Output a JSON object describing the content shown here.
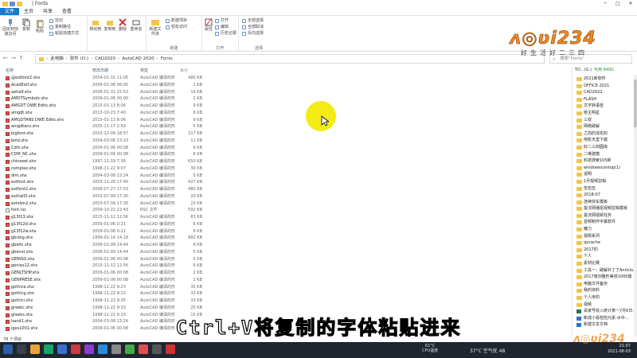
{
  "window": {
    "title": "| Fonts",
    "tabs": [
      "文件",
      "主页",
      "共享",
      "查看"
    ]
  },
  "ribbon": {
    "clipboard": {
      "pin_label": "固定到快速访问",
      "copy_label": "复制",
      "paste_label": "粘贴",
      "cut_label": "剪切",
      "copy_path_label": "复制路径",
      "paste_shortcut_label": "粘贴快捷方式"
    },
    "organize": {
      "move_to_label": "移动到",
      "copy_to_label": "复制到",
      "delete_label": "删除",
      "rename_label": "重命名"
    },
    "new": {
      "new_folder_label": "新建文件夹",
      "new_item_label": "新建项目",
      "easy_access_label": "轻松访问",
      "group_label": "新建"
    },
    "open": {
      "properties_label": "属性",
      "open_label": "打开",
      "edit_label": "编辑",
      "history_label": "历史记录",
      "group_label": "打开"
    },
    "select": {
      "select_all_label": "全部选择",
      "select_none_label": "全部取消",
      "invert_label": "反向选择",
      "group_label": "选择"
    }
  },
  "address": {
    "path": [
      "此电脑",
      "软件 (D:)",
      "CAD2020",
      "AutoCAD 2020",
      "Fonts"
    ],
    "search_placeholder": "搜索\"Fonts\""
  },
  "filelist": {
    "columns": [
      "名称",
      "修改日期",
      "类型",
      "大小"
    ],
    "rows": [
      {
        "name": "@extfont2.shx",
        "date": "2004-01-31 11:05",
        "type": "AutoCAD 编译的形",
        "size": "480 KB",
        "kind": "shx"
      },
      {
        "name": "AcadEref.shx",
        "date": "2009-01-06 06:05",
        "type": "AutoCAD 编译的形",
        "size": "1 KB",
        "kind": "shx"
      },
      {
        "name": "aehalf.shx",
        "date": "2006-01-31 15:53",
        "type": "AutoCAD 编译的形",
        "size": "14 KB",
        "kind": "shx"
      },
      {
        "name": "AMDTSymbols.shx",
        "date": "2009-01-06 00:00",
        "type": "AutoCAD 编译的形",
        "size": "2 KB",
        "kind": "shx"
      },
      {
        "name": "AMGDT DWE Edits.shx",
        "date": "2015-01-13 8:06",
        "type": "AutoCAD 编译的形",
        "size": "9 KB",
        "kind": "shx"
      },
      {
        "name": "amgdt.shx",
        "date": "2013-10-23 7:40",
        "type": "AutoCAD 编译的形",
        "size": "6 KB",
        "kind": "shx"
      },
      {
        "name": "AMGDTANS DWE Edits.shx",
        "date": "2015-01-13 8:06",
        "type": "AutoCAD 编译的形",
        "size": "9 KB",
        "kind": "shx"
      },
      {
        "name": "amgdtans.shx",
        "date": "2005-11-17 2:59",
        "type": "AutoCAD 编译的形",
        "size": "5 KB",
        "kind": "shx"
      },
      {
        "name": "bigfont.shx",
        "date": "2003-12-09 18:57",
        "type": "AutoCAD 编译的形",
        "size": "217 KB",
        "kind": "shx"
      },
      {
        "name": "bold.shx",
        "date": "2004-03-08 23:23",
        "type": "AutoCAD 编译的形",
        "size": "11 KB",
        "kind": "shx"
      },
      {
        "name": "Cdm.shx",
        "date": "2009-01-06 00:08",
        "type": "AutoCAD 编译的形",
        "size": "6 KB",
        "kind": "shx"
      },
      {
        "name": "CDM_NC.shx",
        "date": "2009-01-06 00:08",
        "type": "AutoCAD 编译的形",
        "size": "6 KB",
        "kind": "shx"
      },
      {
        "name": "chineset.shx",
        "date": "1997-11-19 7:36",
        "type": "AutoCAD 编译的形",
        "size": "650 KB",
        "kind": "shx"
      },
      {
        "name": "complex.shx",
        "date": "1998-11-22 9:07",
        "type": "AutoCAD 编译的形",
        "size": "30 KB",
        "kind": "shx"
      },
      {
        "name": "dim.shx",
        "date": "2004-03-08 23:24",
        "type": "AutoCAD 编译的形",
        "size": "5 KB",
        "kind": "shx"
      },
      {
        "name": "extfont.shx",
        "date": "2003-11-28 17:40",
        "type": "AutoCAD 编译的形",
        "size": "427 KB",
        "kind": "shx"
      },
      {
        "name": "extfont2.shx",
        "date": "2006-07-27 17:03",
        "type": "AutoCAD 编译的形",
        "size": "480 KB",
        "kind": "shx"
      },
      {
        "name": "exthalf2.shx",
        "date": "2003-07-09 17:30",
        "type": "AutoCAD 编译的形",
        "size": "20 KB",
        "kind": "shx"
      },
      {
        "name": "extslim2.shx",
        "date": "2003-07-09 17:30",
        "type": "AutoCAD 编译的形",
        "size": "23 KB",
        "kind": "shx"
      },
      {
        "name": "font.rsc",
        "date": "2009-10-21 22:43",
        "type": "RSC 文件",
        "size": "592 KB",
        "kind": "rsc"
      },
      {
        "name": "g13f13.shx",
        "date": "2015-11-12 12:56",
        "type": "AutoCAD 编译的形",
        "size": "63 KB",
        "kind": "shx"
      },
      {
        "name": "g13f12d.shx",
        "date": "2009-01-06 0:21",
        "type": "AutoCAD 编译的形",
        "size": "6 KB",
        "kind": "shx"
      },
      {
        "name": "g13f12w.shx",
        "date": "2009-01-06 0:21",
        "type": "AutoCAD 编译的形",
        "size": "6 KB",
        "kind": "shx"
      },
      {
        "name": "gbcbig.shx",
        "date": "1999-01-14 14:18",
        "type": "AutoCAD 编译的形",
        "size": "882 KB",
        "kind": "shx"
      },
      {
        "name": "gbeitc.shx",
        "date": "2006-02-09 14:44",
        "type": "AutoCAD 编译的形",
        "size": "6 KB",
        "kind": "shx"
      },
      {
        "name": "gbenor.shx",
        "date": "2006-02-09 14:44",
        "type": "AutoCAD 编译的形",
        "size": "5 KB",
        "kind": "shx"
      },
      {
        "name": "GENISO.shx",
        "date": "2009-01-06 00:08",
        "type": "AutoCAD 编译的形",
        "size": "5 KB",
        "kind": "shx"
      },
      {
        "name": "geniso12.shx",
        "date": "2015-11-12 12:56",
        "type": "AutoCAD 编译的形",
        "size": "6 KB",
        "kind": "shx"
      },
      {
        "name": "GENLTSHP.shx",
        "date": "2009-01-06 00:08",
        "type": "AutoCAD 编译的形",
        "size": "2 KB",
        "kind": "shx"
      },
      {
        "name": "GENPRESE.shx",
        "date": "2009-01-06 00:08",
        "type": "AutoCAD 编译的形",
        "size": "1 KB",
        "kind": "shx"
      },
      {
        "name": "gothice.shx",
        "date": "1998-11-22 9:23",
        "type": "AutoCAD 编译的形",
        "size": "35 KB",
        "kind": "shx"
      },
      {
        "name": "gothicg.shx",
        "date": "1998-11-22 9:23",
        "type": "AutoCAD 编译的形",
        "size": "33 KB",
        "kind": "shx"
      },
      {
        "name": "gothici.shx",
        "date": "1998-11-22 9:35",
        "type": "AutoCAD 编译的形",
        "size": "33 KB",
        "kind": "shx"
      },
      {
        "name": "greekc.shx",
        "date": "1998-11-22 9:33",
        "type": "AutoCAD 编译的形",
        "size": "25 KB",
        "kind": "shx"
      },
      {
        "name": "greeks.shx",
        "date": "1998-11-22 9:33",
        "type": "AutoCAD 编译的形",
        "size": "15 KB",
        "kind": "shx"
      },
      {
        "name": "hand1.shx",
        "date": "2004-03-08 23:24",
        "type": "AutoCAD 编译的形",
        "size": "",
        "kind": "shx"
      },
      {
        "name": "iges1001.shx",
        "date": "2009-01-06 00:08",
        "type": "AutoCAD 编译的形",
        "size": "",
        "kind": "shx"
      }
    ]
  },
  "right_panel": {
    "drive_label": "TO...(G:)",
    "available": "可用 640G",
    "items": [
      {
        "label": "2021新软件",
        "icon": "folder"
      },
      {
        "label": "OFFICE-2021",
        "icon": "folder"
      },
      {
        "label": "CAD2022",
        "icon": "folder"
      },
      {
        "label": "FLASH",
        "icon": "folder"
      },
      {
        "label": "文字转语音",
        "icon": "folder"
      },
      {
        "label": "晓主明星",
        "icon": "folder"
      },
      {
        "label": "三双",
        "icon": "folder"
      },
      {
        "label": "网络破解",
        "icon": "folder"
      },
      {
        "label": "之前的混花的",
        "icon": "folder"
      },
      {
        "label": "电影天堂下载",
        "icon": "folder"
      },
      {
        "label": "好二三四图库",
        "icon": "folder"
      },
      {
        "label": "二维建模",
        "icon": "folder"
      },
      {
        "label": "科技搜索105新",
        "icon": "folder"
      },
      {
        "label": "windowscontop(1)",
        "icon": "folder"
      },
      {
        "label": "说明",
        "icon": "folder"
      },
      {
        "label": "1月视频剪辑",
        "icon": "folder"
      },
      {
        "label": "伍伍伍",
        "icon": "folder"
      },
      {
        "label": "2018-07",
        "icon": "folder"
      },
      {
        "label": "连续快车模板",
        "icon": "folder"
      },
      {
        "label": "拔法网播抠视频剪辑模板",
        "icon": "folder"
      },
      {
        "label": "拔法网视频任务",
        "icon": "folder"
      },
      {
        "label": "音频制作字幕软件",
        "icon": "folder"
      },
      {
        "label": "曦力",
        "icon": "folder"
      },
      {
        "label": "视频系列",
        "icon": "folder"
      },
      {
        "label": "qycache",
        "icon": "folder"
      },
      {
        "label": "2017的",
        "icon": "folder"
      },
      {
        "label": "个人",
        "icon": "folder"
      },
      {
        "label": "素材比赛",
        "icon": "folder"
      },
      {
        "label": "工具一：破解补丁了Anticlo...",
        "icon": "folder"
      },
      {
        "label": "2017南浏整形美容1000篇",
        "icon": "folder"
      },
      {
        "label": "电脑文件备份",
        "icon": "folder"
      },
      {
        "label": "我的资料",
        "icon": "folder"
      },
      {
        "label": "个人序的",
        "icon": "folder"
      },
      {
        "label": "视频",
        "icon": "folder"
      },
      {
        "label": "百家号收入统计表一7月6日...",
        "icon": "xls"
      },
      {
        "label": "新成小看检险元素-水中...",
        "icon": "gen"
      },
      {
        "label": "新建文本文档",
        "icon": "gen"
      }
    ]
  },
  "status": {
    "count": "78 个项目"
  },
  "taskbar": {
    "weather_temp": "61°C",
    "weather_label": "CPU温度",
    "temp": "37°C 空气优 48",
    "time": "21:07",
    "date": "2021-08-03"
  },
  "overlay": {
    "subtitle": "Ctrl+V将复制的字体粘贴进来",
    "watermark_logo": "小 OVU 234",
    "watermark_sub": "好生活好二三四",
    "corner_watermark": "小 OVU 234"
  },
  "colors": {
    "file_tab": "#1979ca",
    "cursor_highlight": "#f3eb13",
    "taskbar": "#1f2630",
    "watermark": "#f08a24"
  }
}
